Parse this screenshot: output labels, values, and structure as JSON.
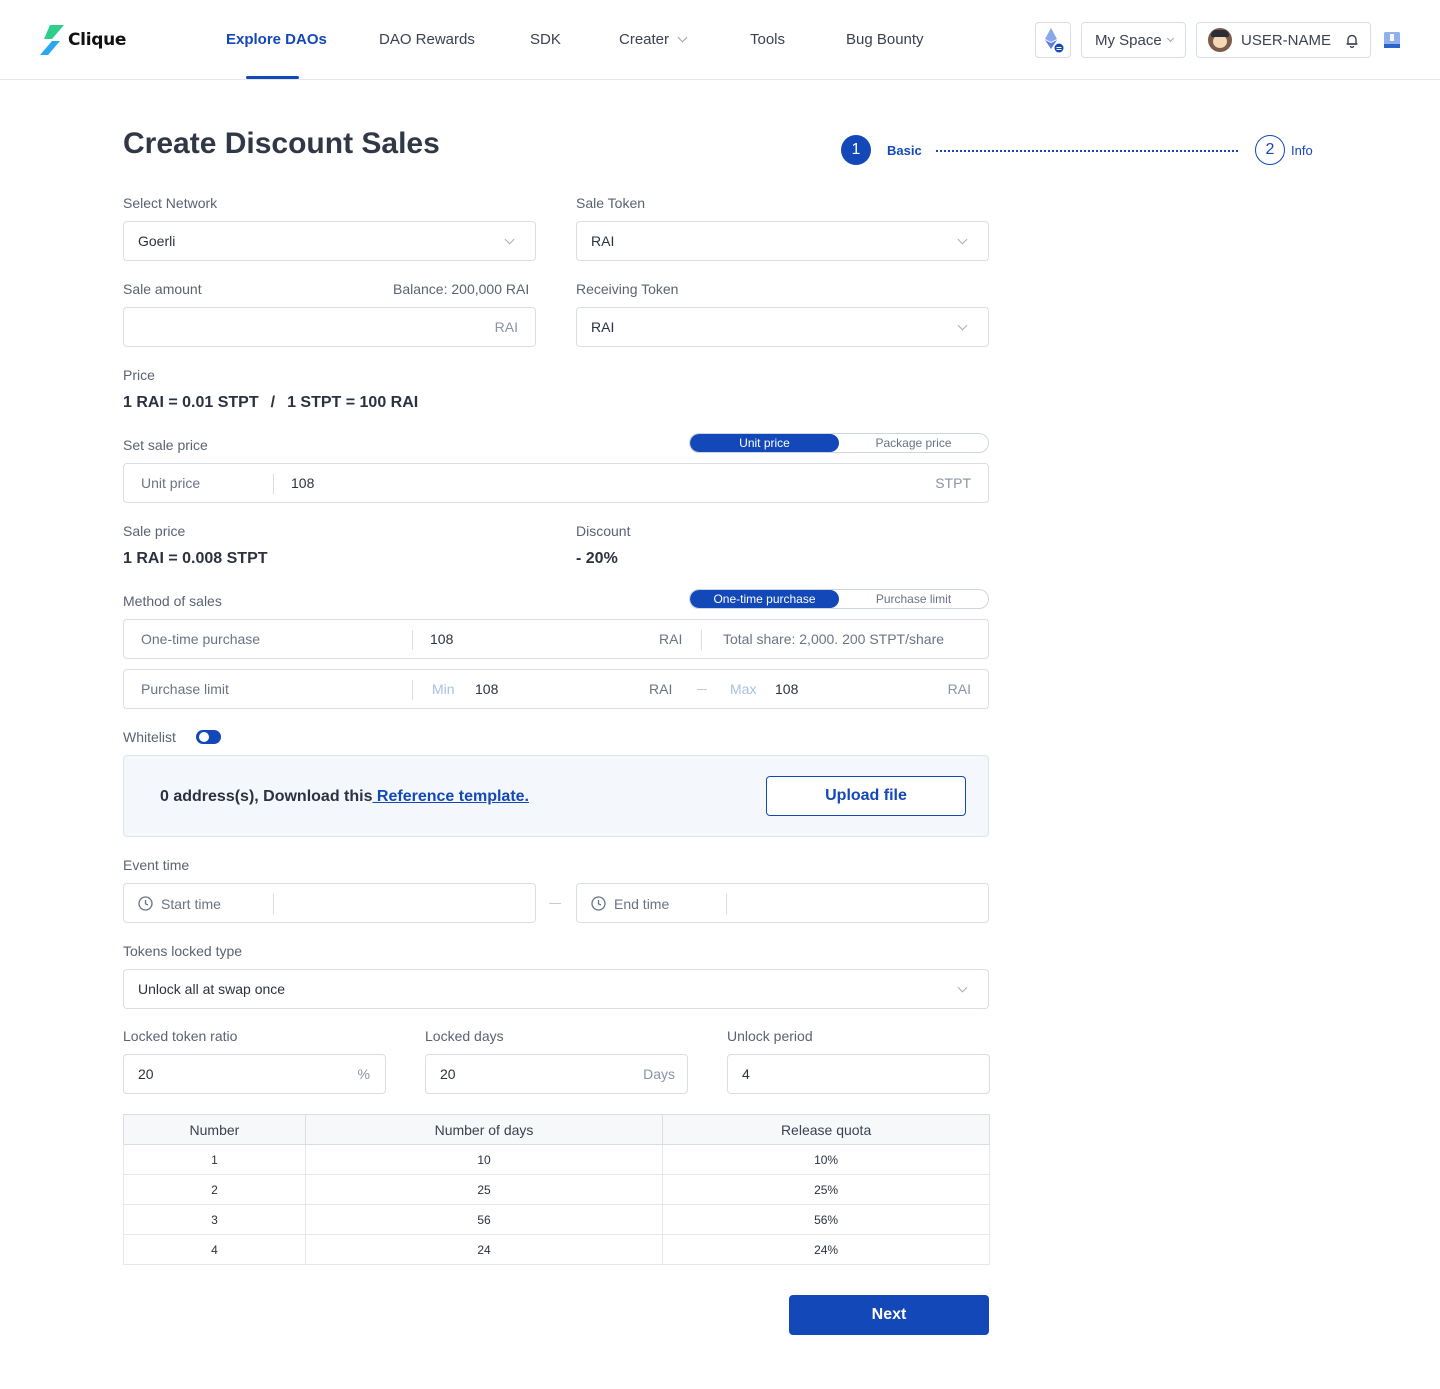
{
  "brand": {
    "name": "Clique"
  },
  "nav": {
    "items": [
      {
        "label": "Explore DAOs",
        "active": true
      },
      {
        "label": "DAO Rewards"
      },
      {
        "label": "SDK"
      },
      {
        "label": "Creater",
        "has_dropdown": true
      },
      {
        "label": "Tools"
      },
      {
        "label": "Bug Bounty"
      }
    ],
    "my_space": "My Space",
    "user_name": "USER-NAME",
    "network_icon": "ethereum-icon"
  },
  "page": {
    "title": "Create Discount Sales",
    "steps": [
      {
        "number": "1",
        "label": "Basic",
        "active": true
      },
      {
        "number": "2",
        "label": "Info",
        "active": false
      }
    ]
  },
  "form": {
    "select_network": {
      "label": "Select Network",
      "value": "Goerli"
    },
    "sale_token": {
      "label": "Sale Token",
      "value": "RAI"
    },
    "sale_amount": {
      "label": "Sale amount",
      "balance": "Balance: 200,000 RAI",
      "value": "",
      "suffix": "RAI"
    },
    "receiving_token": {
      "label": "Receiving Token",
      "value": "RAI"
    },
    "price": {
      "label": "Price",
      "left": "1 RAI = 0.01 STPT",
      "separator": "/",
      "right": "1 STPT = 100 RAI"
    },
    "set_sale_price": {
      "label": "Set sale price",
      "toggle": [
        "Unit price",
        "Package price"
      ],
      "toggle_selected": "Unit price",
      "field_label": "Unit price",
      "value": "108",
      "suffix": "STPT"
    },
    "sale_price": {
      "label": "Sale price",
      "value": "1 RAI = 0.008 STPT"
    },
    "discount": {
      "label": "Discount",
      "value": "- 20%"
    },
    "method_of_sales": {
      "label": "Method of sales",
      "toggle": [
        "One-time purchase",
        "Purchase limit"
      ],
      "toggle_selected": "One-time purchase",
      "one_time": {
        "label": "One-time purchase",
        "value": "108",
        "unit": "RAI",
        "info": "Total share: 2,000.  200 STPT/share"
      },
      "purchase_limit": {
        "label": "Purchase limit",
        "min_label": "Min",
        "min_value": "108",
        "min_unit": "RAI",
        "max_label": "Max",
        "max_value": "108",
        "max_unit": "RAI"
      }
    },
    "whitelist": {
      "label": "Whitelist",
      "enabled": true,
      "text": "0 address(s), Download this",
      "link": " Reference template.",
      "upload_button": "Upload file"
    },
    "event_time": {
      "label": "Event time",
      "start_placeholder": "Start time",
      "end_placeholder": "End time"
    },
    "tokens_locked_type": {
      "label": "Tokens locked type",
      "value": "Unlock all at swap once"
    },
    "locked_token_ratio": {
      "label": "Locked token ratio",
      "value": "20",
      "suffix": "%"
    },
    "locked_days": {
      "label": "Locked  days",
      "value": "20",
      "suffix": "Days"
    },
    "unlock_period": {
      "label": "Unlock period",
      "value": "4"
    }
  },
  "release_table": {
    "headers": [
      "Number",
      "Number of days",
      "Release quota"
    ],
    "rows": [
      [
        "1",
        "10",
        "10%"
      ],
      [
        "2",
        "25",
        "25%"
      ],
      [
        "3",
        "56",
        "56%"
      ],
      [
        "4",
        "24",
        "24%"
      ]
    ]
  },
  "actions": {
    "next": "Next"
  },
  "colors": {
    "primary": "#1348b8",
    "text": "#2b3140",
    "muted": "#6b7383",
    "border": "#d9dde4"
  }
}
